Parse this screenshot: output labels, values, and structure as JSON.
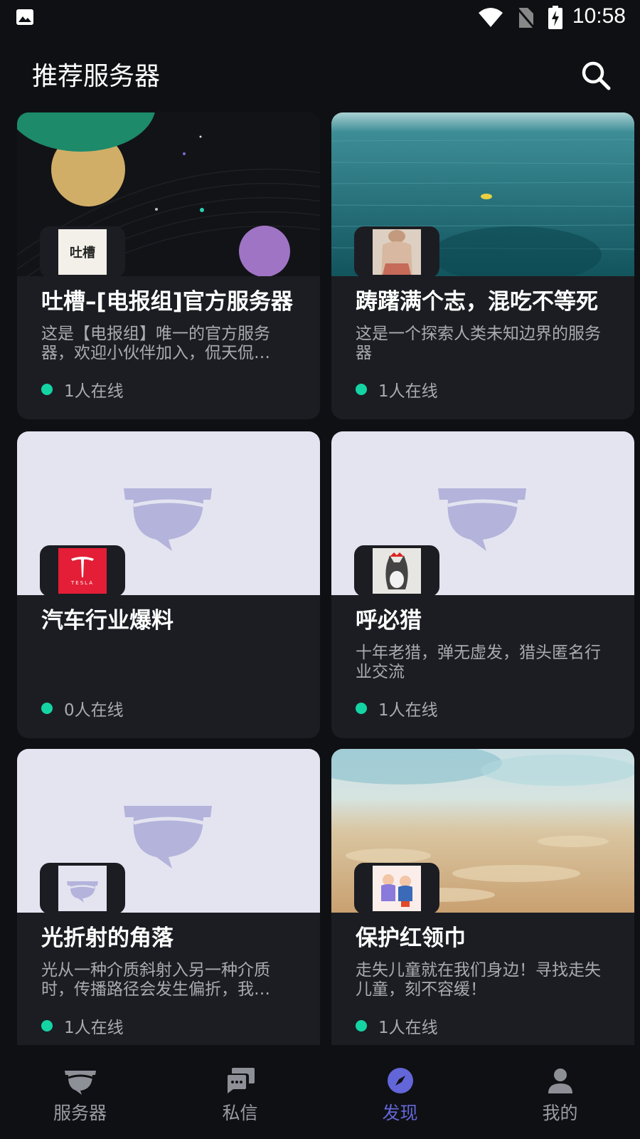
{
  "status_bar": {
    "time": "10:58"
  },
  "header": {
    "title": "推荐服务器"
  },
  "servers": [
    {
      "name": "吐槽–[电报组]官方服务器",
      "description": "这是【电报组】唯一的官方服务器，欢迎小伙伴加入，侃天侃…",
      "online": "1人在线",
      "avatar_text": "吐槽"
    },
    {
      "name": "踌躇满个志，混吃不等死",
      "description": "这是一个探索人类未知边界的服务器",
      "online": "1人在线"
    },
    {
      "name": "汽车行业爆料",
      "description": "",
      "online": "0人在线",
      "avatar_text": "TESLA"
    },
    {
      "name": "呼必猎",
      "description": "十年老猎，弹无虚发，猎头匿名行业交流",
      "online": "1人在线"
    },
    {
      "name": "光折射的角落",
      "description": "光从一种介质斜射入另一种介质时，传播路径会发生偏折，我…",
      "online": "1人在线"
    },
    {
      "name": "保护红领巾",
      "description": "走失儿童就在我们身边！寻找走失儿童，刻不容缓！",
      "online": "1人在线"
    }
  ],
  "tabs": [
    {
      "label": "服务器",
      "icon": "server-icon",
      "active": false
    },
    {
      "label": "私信",
      "icon": "message-icon",
      "active": false
    },
    {
      "label": "发现",
      "icon": "compass-icon",
      "active": true
    },
    {
      "label": "我的",
      "icon": "user-icon",
      "active": false
    }
  ],
  "colors": {
    "accent": "#6366d8",
    "online": "#14d4a4",
    "card": "#1c1d22",
    "background": "#0f1013"
  }
}
